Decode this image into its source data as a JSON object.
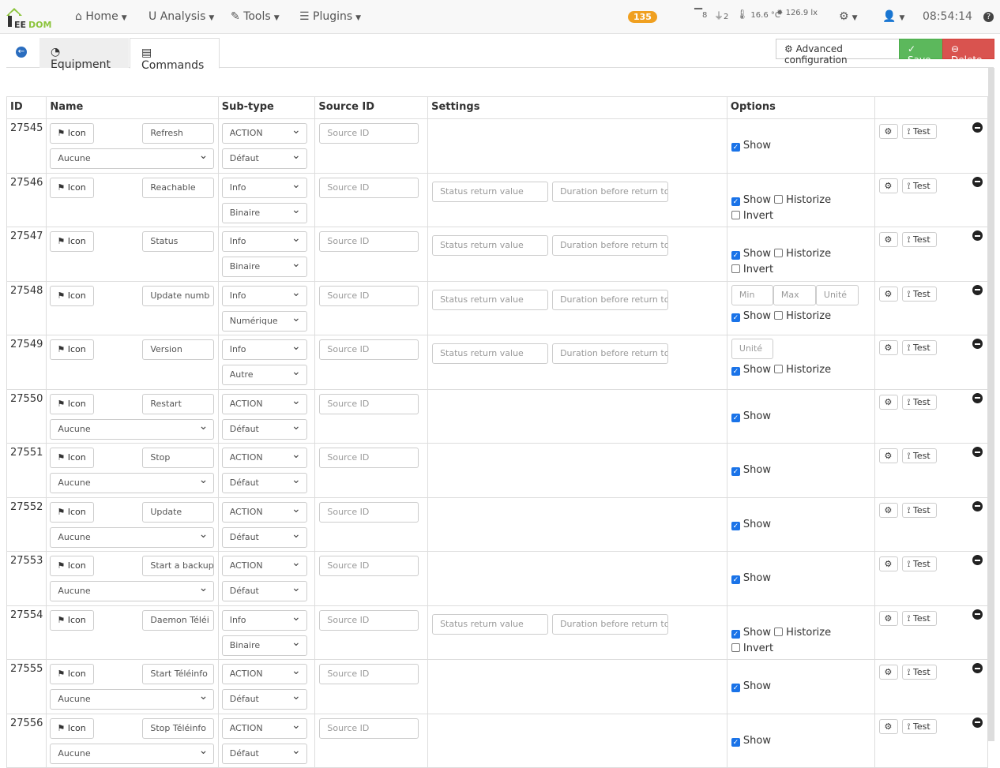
{
  "nav": {
    "logo": "JEEDOM",
    "menus": [
      {
        "icon": "home-icon",
        "label": "Home"
      },
      {
        "icon": "stethoscope-icon",
        "label": "Analysis"
      },
      {
        "icon": "wrench-icon",
        "label": "Tools"
      },
      {
        "icon": "tasks-icon",
        "label": "Plugins"
      }
    ],
    "badge": "135",
    "shutters": "8",
    "plugs": "2",
    "temperature": "16.6 °C",
    "luminosity": "126.9 lx",
    "clock": "08:54:14"
  },
  "tabs": {
    "equipment": "Equipment",
    "commands": "Commands"
  },
  "actions": {
    "advanced": "Advanced configuration",
    "save": "Save",
    "delete": "Delete"
  },
  "table": {
    "headers": [
      "ID",
      "Name",
      "Sub-type",
      "Source ID",
      "Settings",
      "Options",
      ""
    ],
    "icon_label": "Icon",
    "test_label": "Test",
    "source_placeholder": "Source ID",
    "status_placeholder": "Status return value",
    "duration_placeholder": "Duration before return to",
    "min_placeholder": "Min",
    "max_placeholder": "Max",
    "unit_placeholder": "Unité",
    "show": "Show",
    "historize": "Historize",
    "invert": "Invert",
    "rows": [
      {
        "id": "27545",
        "name": "Refresh",
        "type": "ACTION",
        "subtype": "Défaut",
        "generic": "Aucune",
        "kind": "action"
      },
      {
        "id": "27546",
        "name": "Reachable",
        "type": "Info",
        "subtype": "Binaire",
        "kind": "binary"
      },
      {
        "id": "27547",
        "name": "Status",
        "type": "Info",
        "subtype": "Binaire",
        "kind": "binary"
      },
      {
        "id": "27548",
        "name": "Update numb",
        "type": "Info",
        "subtype": "Numérique",
        "kind": "numeric"
      },
      {
        "id": "27549",
        "name": "Version",
        "type": "Info",
        "subtype": "Autre",
        "kind": "other"
      },
      {
        "id": "27550",
        "name": "Restart",
        "type": "ACTION",
        "subtype": "Défaut",
        "generic": "Aucune",
        "kind": "action"
      },
      {
        "id": "27551",
        "name": "Stop",
        "type": "ACTION",
        "subtype": "Défaut",
        "generic": "Aucune",
        "kind": "action"
      },
      {
        "id": "27552",
        "name": "Update",
        "type": "ACTION",
        "subtype": "Défaut",
        "generic": "Aucune",
        "kind": "action"
      },
      {
        "id": "27553",
        "name": "Start a backup",
        "type": "ACTION",
        "subtype": "Défaut",
        "generic": "Aucune",
        "kind": "action"
      },
      {
        "id": "27554",
        "name": "Daemon Téléi",
        "type": "Info",
        "subtype": "Binaire",
        "kind": "binary"
      },
      {
        "id": "27555",
        "name": "Start Téléinfo",
        "type": "ACTION",
        "subtype": "Défaut",
        "generic": "Aucune",
        "kind": "action"
      },
      {
        "id": "27556",
        "name": "Stop Téléinfo",
        "type": "ACTION",
        "subtype": "Défaut",
        "generic": "Aucune",
        "kind": "action"
      }
    ]
  }
}
